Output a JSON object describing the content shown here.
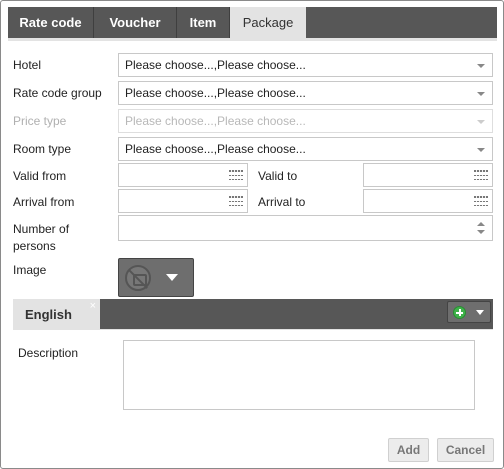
{
  "tabs": [
    {
      "label": "Rate code",
      "active": false
    },
    {
      "label": "Voucher",
      "active": false
    },
    {
      "label": "Item",
      "active": false
    },
    {
      "label": "Package",
      "active": true
    }
  ],
  "form": {
    "hotel": {
      "label": "Hotel",
      "value": "Please choose...,Please choose..."
    },
    "rate_code_group": {
      "label": "Rate code group",
      "value": "Please choose...,Please choose..."
    },
    "price_type": {
      "label": "Price type",
      "value": "Please choose...,Please choose...",
      "disabled": true
    },
    "room_type": {
      "label": "Room type",
      "value": "Please choose...,Please choose..."
    },
    "valid_from": {
      "label": "Valid from",
      "value": ""
    },
    "valid_to": {
      "label": "Valid to",
      "value": ""
    },
    "arrival_from": {
      "label": "Arrival from",
      "value": ""
    },
    "arrival_to": {
      "label": "Arrival to",
      "value": ""
    },
    "number_of_persons": {
      "label_line1": "Number of",
      "label_line2": "persons",
      "value": ""
    },
    "image": {
      "label": "Image",
      "icon": "no-image-icon"
    }
  },
  "language": {
    "active_tab": "English",
    "close_glyph": "×",
    "add_icon": "plus-circle-icon"
  },
  "description": {
    "label": "Description",
    "value": ""
  },
  "buttons": {
    "add": "Add",
    "cancel": "Cancel"
  },
  "colors": {
    "tabbar_bg": "#575757",
    "active_tab_bg": "#e3e3e3",
    "add_icon_green": "#3fb24a"
  }
}
